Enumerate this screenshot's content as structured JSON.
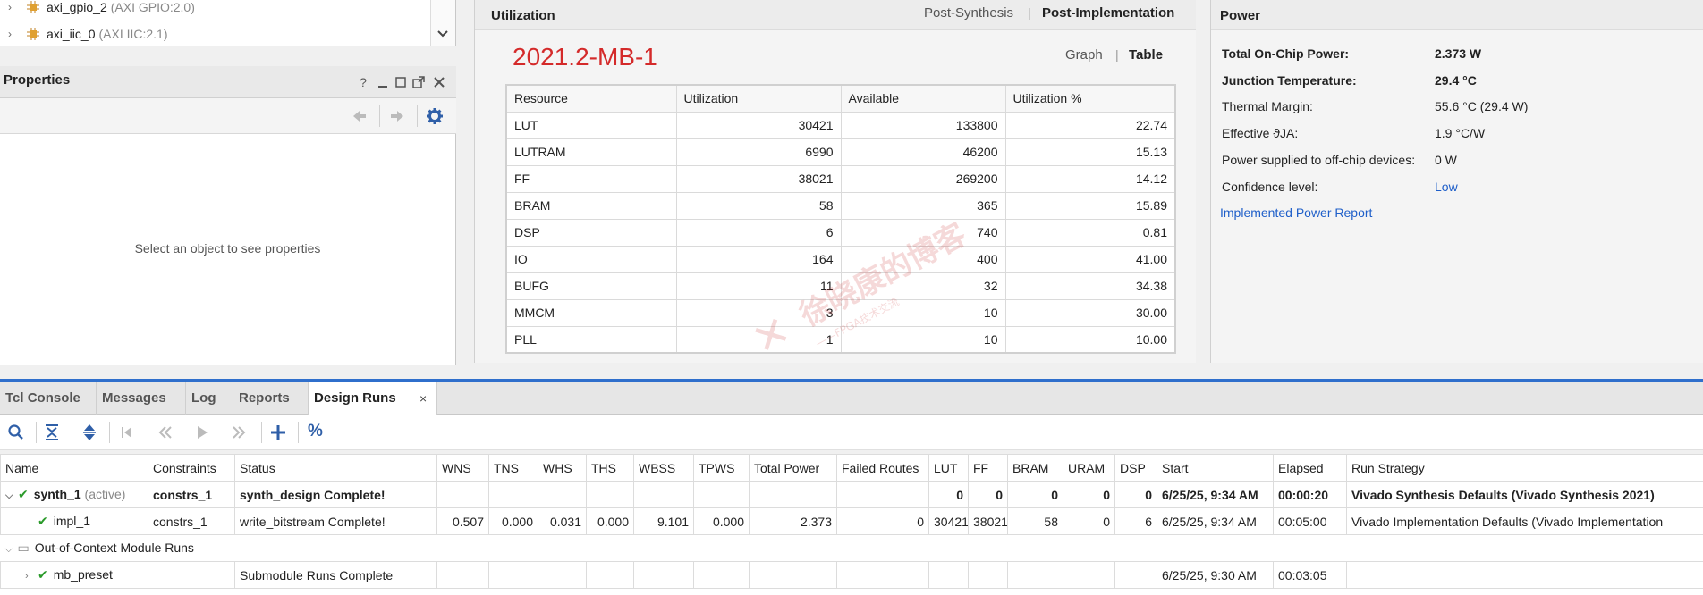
{
  "tree": {
    "items": [
      {
        "name": "axi_gpio_2",
        "sub": "(AXI GPIO:2.0)"
      },
      {
        "name": "axi_iic_0",
        "sub": "(AXI IIC:2.1)"
      }
    ]
  },
  "properties": {
    "title": "Properties",
    "help": "?",
    "empty_text": "Select an object to see properties"
  },
  "utilization": {
    "title": "Utilization",
    "tab_post_synthesis": "Post-Synthesis",
    "tab_post_implementation": "Post-Implementation",
    "run_name": "2021.2-MB-1",
    "view_graph": "Graph",
    "view_table": "Table",
    "columns": [
      "Resource",
      "Utilization",
      "Available",
      "Utilization %"
    ],
    "rows": [
      {
        "resource": "LUT",
        "utilization": "30421",
        "available": "133800",
        "pct": "22.74"
      },
      {
        "resource": "LUTRAM",
        "utilization": "6990",
        "available": "46200",
        "pct": "15.13"
      },
      {
        "resource": "FF",
        "utilization": "38021",
        "available": "269200",
        "pct": "14.12"
      },
      {
        "resource": "BRAM",
        "utilization": "58",
        "available": "365",
        "pct": "15.89"
      },
      {
        "resource": "DSP",
        "utilization": "6",
        "available": "740",
        "pct": "0.81"
      },
      {
        "resource": "IO",
        "utilization": "164",
        "available": "400",
        "pct": "41.00"
      },
      {
        "resource": "BUFG",
        "utilization": "11",
        "available": "32",
        "pct": "34.38"
      },
      {
        "resource": "MMCM",
        "utilization": "3",
        "available": "10",
        "pct": "30.00"
      },
      {
        "resource": "PLL",
        "utilization": "1",
        "available": "10",
        "pct": "10.00"
      }
    ]
  },
  "power": {
    "title": "Power",
    "total_label": "Total On-Chip Power:",
    "total_value": "2.373 W",
    "junction_label": "Junction Temperature:",
    "junction_value": "29.4 °C",
    "margin_label": "Thermal Margin:",
    "margin_value": "55.6 °C (29.4 W)",
    "theta_label": "Effective ϑJA:",
    "theta_value": "1.9 °C/W",
    "offchip_label": "Power supplied to off-chip devices:",
    "offchip_value": "0 W",
    "confidence_label": "Confidence level:",
    "confidence_value": "Low",
    "report_link": "Implemented Power Report"
  },
  "bottom_tabs": {
    "tcl": "Tcl Console",
    "messages": "Messages",
    "log": "Log",
    "reports": "Reports",
    "design_runs": "Design Runs",
    "close": "×",
    "percent": "%"
  },
  "runs": {
    "columns": [
      "Name",
      "Constraints",
      "Status",
      "WNS",
      "TNS",
      "WHS",
      "THS",
      "WBSS",
      "TPWS",
      "Total Power",
      "Failed Routes",
      "LUT",
      "FF",
      "BRAM",
      "URAM",
      "DSP",
      "Start",
      "Elapsed",
      "Run Strategy"
    ],
    "synth": {
      "name": "synth_1",
      "tag": "(active)",
      "constraints": "constrs_1",
      "status": "synth_design Complete!",
      "lut": "0",
      "ff": "0",
      "bram": "0",
      "uram": "0",
      "dsp": "0",
      "start": "6/25/25, 9:34 AM",
      "elapsed": "00:00:20",
      "strategy": "Vivado Synthesis Defaults (Vivado Synthesis 2021)"
    },
    "impl": {
      "name": "impl_1",
      "constraints": "constrs_1",
      "status": "write_bitstream Complete!",
      "wns": "0.507",
      "tns": "0.000",
      "whs": "0.031",
      "ths": "0.000",
      "wbss": "9.101",
      "tpws": "0.000",
      "total_power": "2.373",
      "failed_routes": "0",
      "lut": "30421",
      "ff": "38021",
      "bram": "58",
      "uram": "0",
      "dsp": "6",
      "start": "6/25/25, 9:34 AM",
      "elapsed": "00:05:00",
      "strategy": "Vivado Implementation Defaults (Vivado Implementation"
    },
    "ooc_label": "Out-of-Context Module Runs",
    "preset": {
      "name": "mb_preset",
      "status": "Submodule Runs Complete",
      "start": "6/25/25, 9:30 AM",
      "elapsed": "00:03:05"
    }
  },
  "colors": {
    "accent": "#2f6fcc",
    "run_name": "#d42a2a",
    "ok_check": "#2a9a2a",
    "link": "#1f5fc9"
  }
}
